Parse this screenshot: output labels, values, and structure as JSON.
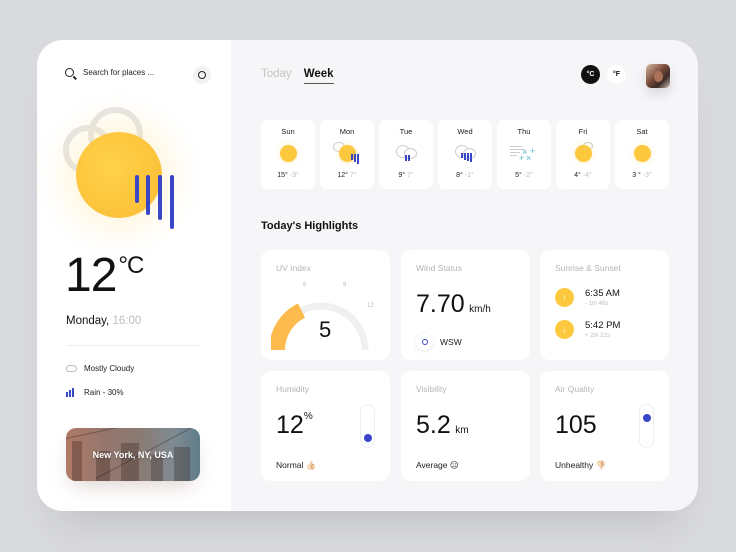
{
  "search": {
    "placeholder": "Search for places ...",
    "icon": "search-icon",
    "location_icon": "crosshair-icon"
  },
  "current": {
    "temperature": "12",
    "unit": "°C",
    "day": "Monday,",
    "time": "16:00",
    "conditions": [
      {
        "icon": "cloud-icon",
        "label": "Mostly Cloudy"
      },
      {
        "icon": "rain-icon",
        "label": "Rain - 30%"
      }
    ],
    "city": "New York, NY, USA"
  },
  "tabs": [
    {
      "label": "Today",
      "active": false
    },
    {
      "label": "Week",
      "active": true
    }
  ],
  "units": {
    "celsius": "°C",
    "fahrenheit": "°F",
    "selected": "°C"
  },
  "week": [
    {
      "day": "Sun",
      "icon": "sun-icon",
      "high": "15°",
      "low": "-3°"
    },
    {
      "day": "Mon",
      "icon": "sun-cloud-rain-icon",
      "high": "12°",
      "low": "7°"
    },
    {
      "day": "Tue",
      "icon": "cloud-rain-icon",
      "high": "9°",
      "low": "7°"
    },
    {
      "day": "Wed",
      "icon": "cloud-heavy-rain-icon",
      "high": "8°",
      "low": "-1°"
    },
    {
      "day": "Thu",
      "icon": "wind-snow-icon",
      "high": "5°",
      "low": "-2°"
    },
    {
      "day": "Fri",
      "icon": "sun-cloud-icon",
      "high": "4°",
      "low": "-4°"
    },
    {
      "day": "Sat",
      "icon": "sun-icon",
      "high": "3 °",
      "low": "-3°"
    }
  ],
  "highlights": {
    "title": "Today's Highlights",
    "uv": {
      "label": "UV Index",
      "value": "5",
      "value_num": 5,
      "max": 12,
      "ticks": [
        "6",
        "9",
        "12"
      ],
      "color": "#fdbb4e"
    },
    "wind": {
      "label": "Wind Status",
      "value": "7.70",
      "unit": "km/h",
      "direction": "WSW"
    },
    "sun": {
      "label": "Sunrise & Sunset",
      "sunrise": {
        "time": "6:35 AM",
        "delta": "- 1m 46s",
        "icon": "arrow-up-icon"
      },
      "sunset": {
        "time": "5:42 PM",
        "delta": "+ 2m 22s",
        "icon": "arrow-down-icon"
      }
    },
    "humidity": {
      "label": "Humidity",
      "value": "12",
      "unit": "%",
      "status": "Normal 👍🏻",
      "level": 0.12
    },
    "visibility": {
      "label": "Visibility",
      "value": "5.2",
      "unit": "km",
      "status": "Average 😐"
    },
    "air": {
      "label": "Air Quality",
      "value": "105",
      "status": "Unhealthy 👎🏻",
      "level": 0.8
    }
  },
  "colors": {
    "accent": "#3946c8",
    "sun": "#fcc83e",
    "dark": "#111111"
  }
}
